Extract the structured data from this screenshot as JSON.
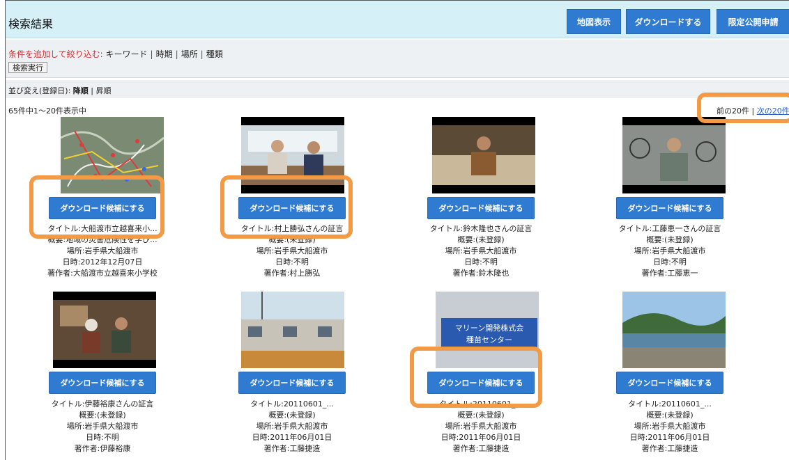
{
  "header": {
    "title": "検索結果",
    "buttons": {
      "map": "地図表示",
      "download": "ダウンロードする",
      "request": "限定公開申請"
    }
  },
  "filter": {
    "condition_label": "条件を追加して絞り込む:",
    "links": [
      "キーワード",
      "時期",
      "場所",
      "種類"
    ],
    "separator": "|",
    "execute_label": "検索実行"
  },
  "sort": {
    "label": "並び変え(登録日):",
    "desc": "降順",
    "sep": "|",
    "asc": "昇順"
  },
  "results": {
    "count_text": "65件中1〜20件表示中",
    "prev": "前の20件",
    "sep": "|",
    "next": "次の20件"
  },
  "colors": {
    "accent": "#2f7bd2",
    "highlight": "#f39a47",
    "header_bg": "#d6f0f8",
    "condition": "#d23030"
  },
  "candidate_label": "ダウンロード候補にする",
  "items": [
    {
      "title": "タイトル:大船渡市立越喜来小...",
      "summary": "概要:地域の災害危険性を学び...",
      "place": "場所:岩手県大船渡市",
      "date": "日時:2012年12月07日",
      "author": "著作者:大船渡市立越喜来小学校"
    },
    {
      "title": "タイトル:村上勝弘さんの証言",
      "summary": "概要:(未登録)",
      "place": "場所:岩手県大船渡市",
      "date": "日時:不明",
      "author": "著作者:村上勝弘"
    },
    {
      "title": "タイトル:鈴木隆也さんの証言",
      "summary": "概要:(未登録)",
      "place": "場所:岩手県大船渡市",
      "date": "日時:不明",
      "author": "著作者:鈴木隆也"
    },
    {
      "title": "タイトル:工藤恵一さんの証言",
      "summary": "概要:(未登録)",
      "place": "場所:岩手県大船渡市",
      "date": "日時:不明",
      "author": "著作者:工藤恵一"
    },
    {
      "title": "タイトル:伊藤裕康さんの証言",
      "summary": "概要:(未登録)",
      "place": "場所:岩手県大船渡市",
      "date": "日時:不明",
      "author": "著作者:伊藤裕康"
    },
    {
      "title": "タイトル:20110601_...",
      "summary": "概要:(未登録)",
      "place": "場所:岩手県大船渡市",
      "date": "日時:2011年06月01日",
      "author": "著作者:工藤捷造"
    },
    {
      "title": "タイトル:20110601_...",
      "summary": "概要:(未登録)",
      "place": "場所:岩手県大船渡市",
      "date": "日時:2011年06月01日",
      "author": "著作者:工藤捷造"
    },
    {
      "title": "タイトル:20110601_...",
      "summary": "概要:(未登録)",
      "place": "場所:岩手県大船渡市",
      "date": "日時:2011年06月01日",
      "author": "著作者:工藤捷造"
    }
  ],
  "thumbnail_signs": {
    "item7_sign": "マリーン開発株式会社 種苗センター"
  }
}
